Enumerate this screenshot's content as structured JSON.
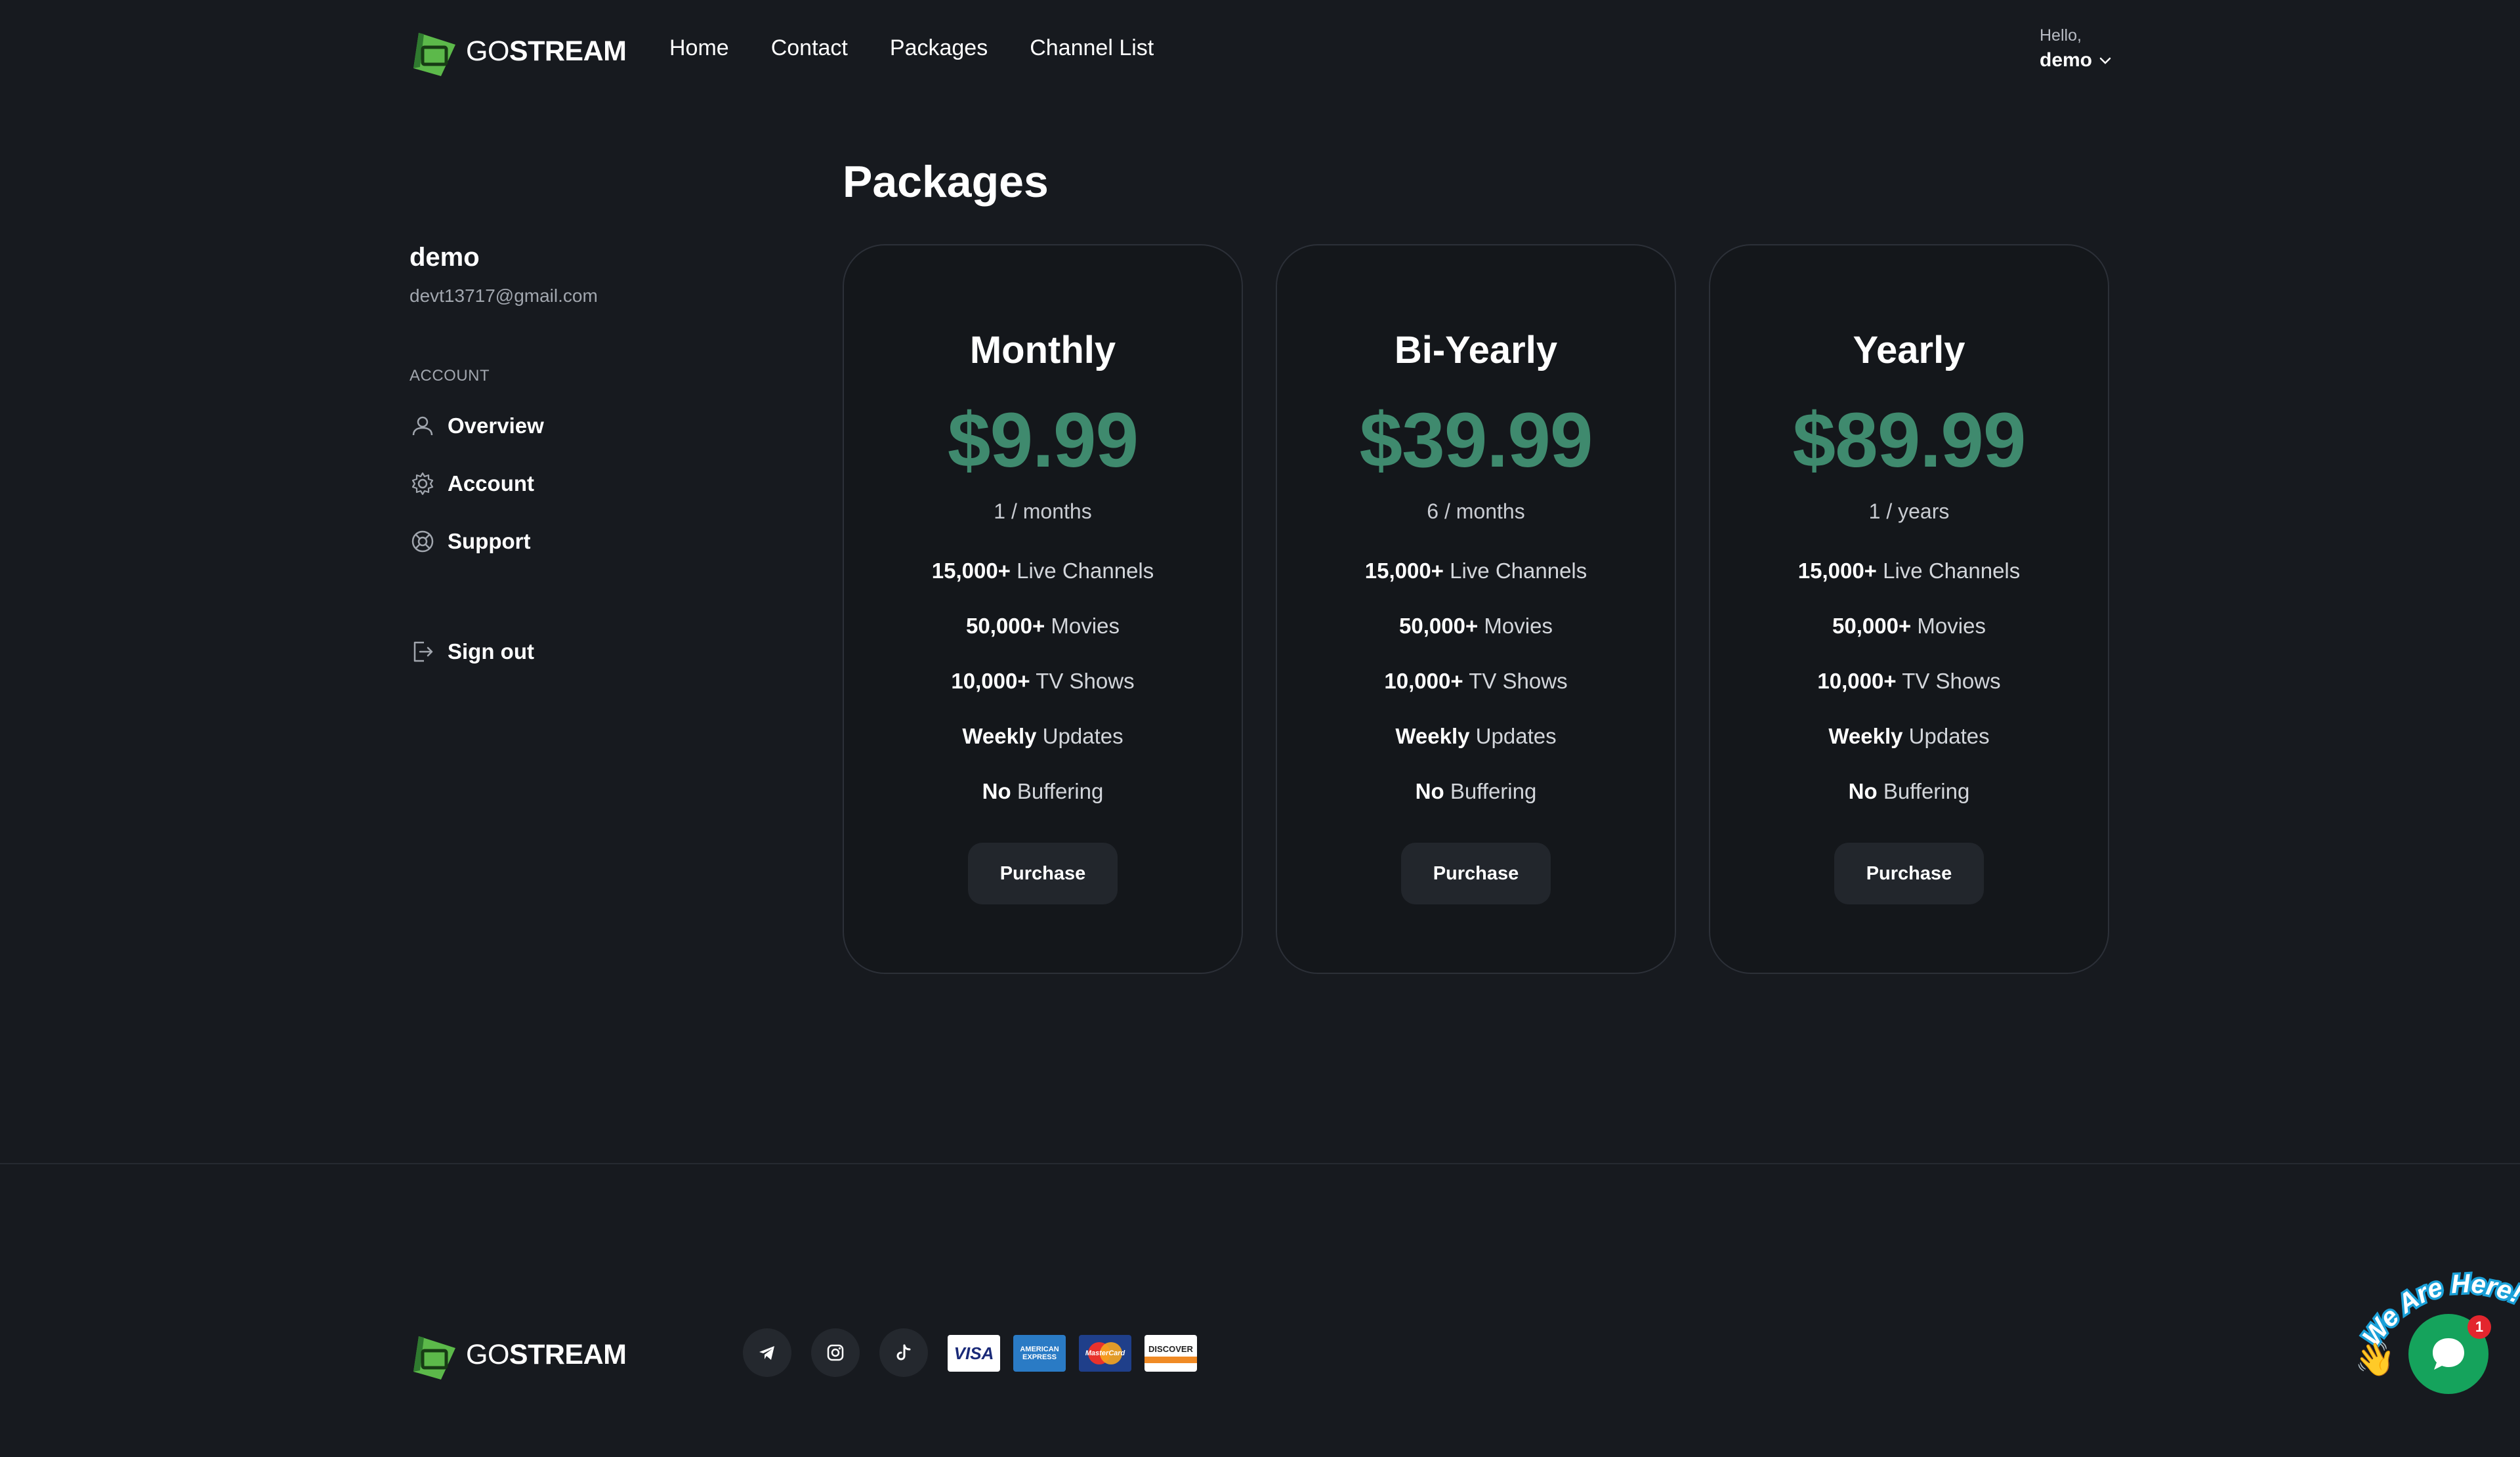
{
  "brand": {
    "prefix": "GO",
    "name": "STREAM",
    "green": "#5cb94a",
    "dark_green": "#2f7a2f"
  },
  "nav": {
    "items": [
      "Home",
      "Contact",
      "Packages",
      "Channel List"
    ]
  },
  "user_menu": {
    "greeting": "Hello,",
    "username": "demo"
  },
  "sidebar": {
    "name": "demo",
    "email": "devt13717@gmail.com",
    "section_label": "ACCOUNT",
    "items": [
      {
        "label": "Overview",
        "icon": "user-icon"
      },
      {
        "label": "Account",
        "icon": "gear-icon"
      },
      {
        "label": "Support",
        "icon": "lifebuoy-icon"
      }
    ],
    "signout": {
      "label": "Sign out",
      "icon": "logout-icon"
    }
  },
  "main": {
    "title": "Packages"
  },
  "packages": [
    {
      "name": "Monthly",
      "price": "$9.99",
      "period": "1 / months",
      "features": [
        {
          "bold": "15,000+",
          "text": " Live Channels"
        },
        {
          "bold": "50,000+",
          "text": " Movies"
        },
        {
          "bold": "10,000+",
          "text": " TV Shows"
        },
        {
          "bold": "Weekly",
          "text": " Updates"
        },
        {
          "bold": "No",
          "text": " Buffering"
        }
      ],
      "button": "Purchase"
    },
    {
      "name": "Bi-Yearly",
      "price": "$39.99",
      "period": "6 / months",
      "features": [
        {
          "bold": "15,000+",
          "text": " Live Channels"
        },
        {
          "bold": "50,000+",
          "text": " Movies"
        },
        {
          "bold": "10,000+",
          "text": " TV Shows"
        },
        {
          "bold": "Weekly",
          "text": " Updates"
        },
        {
          "bold": "No",
          "text": " Buffering"
        }
      ],
      "button": "Purchase"
    },
    {
      "name": "Yearly",
      "price": "$89.99",
      "period": "1 / years",
      "features": [
        {
          "bold": "15,000+",
          "text": " Live Channels"
        },
        {
          "bold": "50,000+",
          "text": " Movies"
        },
        {
          "bold": "10,000+",
          "text": " TV Shows"
        },
        {
          "bold": "Weekly",
          "text": " Updates"
        },
        {
          "bold": "No",
          "text": " Buffering"
        }
      ],
      "button": "Purchase"
    }
  ],
  "footer": {
    "social": [
      "telegram-icon",
      "instagram-icon",
      "tiktok-icon"
    ],
    "payments": {
      "visa": "VISA",
      "amex": "AMERICAN EXPRESS",
      "mastercard": "MasterCard",
      "discover": "DISCOVER"
    }
  },
  "chat": {
    "bubble_text": "We Are Here!",
    "badge": "1",
    "hand": "👋"
  },
  "colors": {
    "background": "#171a1f",
    "card_bg": "#14171b",
    "card_border": "#2c3038",
    "price_green": "#3f8a6e",
    "button_bg": "#22262c"
  }
}
